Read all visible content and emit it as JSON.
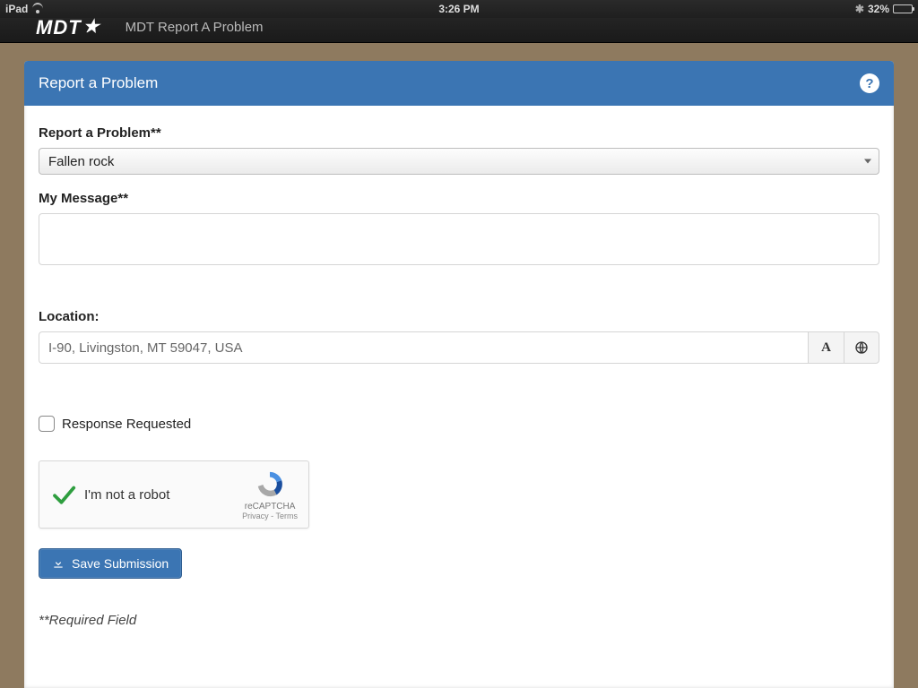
{
  "statusbar": {
    "device": "iPad",
    "time": "3:26 PM",
    "battery_pct": "32%"
  },
  "appbar": {
    "logo_text": "MDT",
    "title": "MDT Report A Problem"
  },
  "panel": {
    "heading": "Report a Problem"
  },
  "form": {
    "problem_label": "Report a Problem**",
    "problem_value": "Fallen rock",
    "message_label": "My Message**",
    "message_value": "",
    "location_label": "Location:",
    "location_value": "I-90, Livingston, MT 59047, USA",
    "response_label": "Response Requested",
    "save_label": "Save Submission",
    "required_note": "**Required Field"
  },
  "recaptcha": {
    "label": "I'm not a robot",
    "brand": "reCAPTCHA",
    "links": "Privacy - Terms"
  }
}
